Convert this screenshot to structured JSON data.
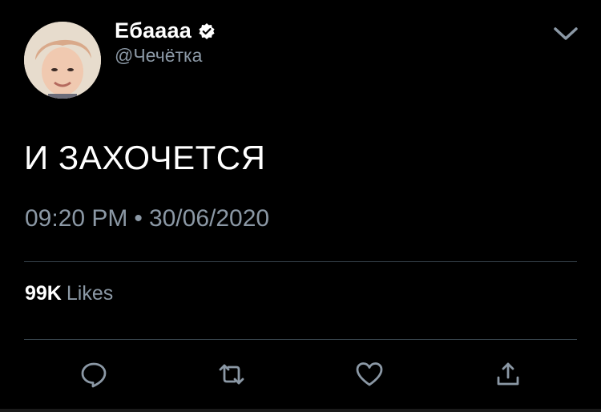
{
  "tweet": {
    "display_name": "Ебаааа",
    "handle": "@Чечётка",
    "text": "И ЗАХОЧЕТСЯ",
    "time": "09:20 PM",
    "date": "30/06/2020",
    "separator": "•",
    "likes_count": "99K",
    "likes_label": "Likes"
  },
  "icons": {
    "verified": "verified-badge-icon",
    "menu": "chevron-down-icon",
    "reply": "reply-icon",
    "retweet": "retweet-icon",
    "like": "heart-icon",
    "share": "share-icon"
  },
  "colors": {
    "background": "#000000",
    "text_primary": "#ffffff",
    "text_secondary": "#8b98a5",
    "divider": "#38444d",
    "icon": "#8b98a5"
  }
}
